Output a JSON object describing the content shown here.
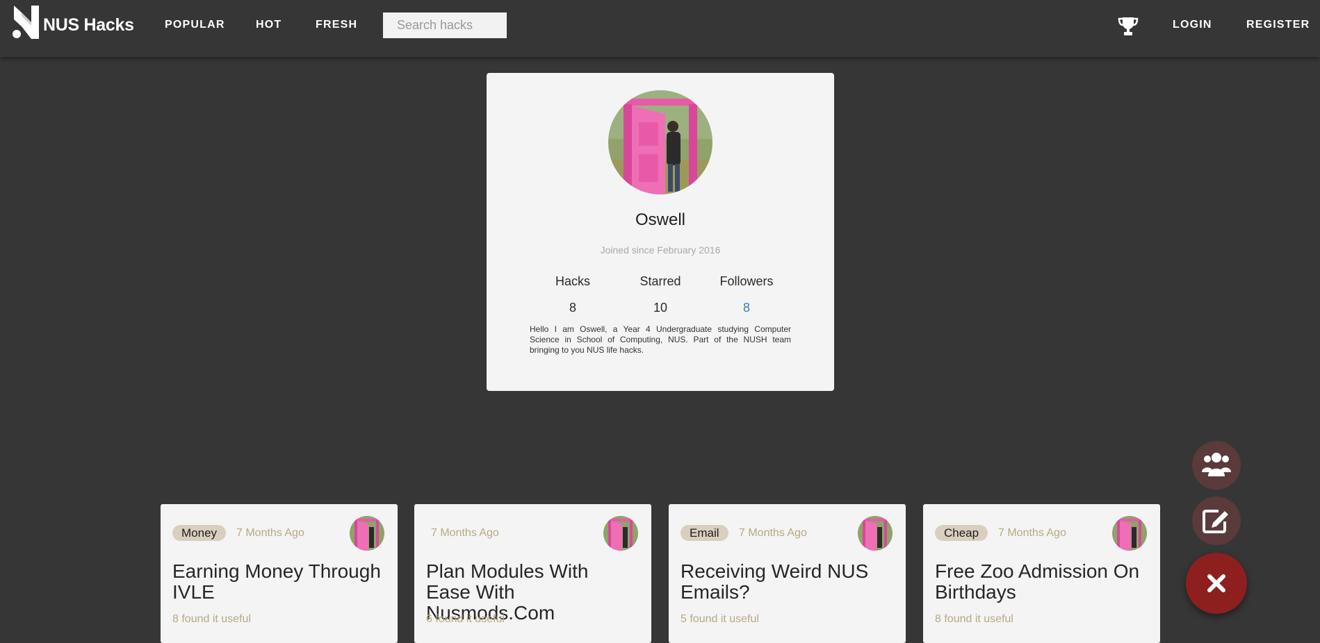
{
  "nav": {
    "brand": "NUS Hacks",
    "links": [
      "POPULAR",
      "HOT",
      "FRESH"
    ],
    "search_placeholder": "Search hacks",
    "login": "LOGIN",
    "register": "REGISTER"
  },
  "profile": {
    "name": "Oswell",
    "joined": "Joined since February 2016",
    "stats": [
      {
        "label": "Hacks",
        "value": "8"
      },
      {
        "label": "Starred",
        "value": "10"
      },
      {
        "label": "Followers",
        "value": "8"
      }
    ],
    "bio": "Hello I am Oswell, a Year 4 Undergraduate studying Computer Science in School of Computing, NUS. Part of the NUSH team bringing to you NUS life hacks."
  },
  "hacks": [
    {
      "tag": "Money",
      "time": "7 Months Ago",
      "title": "Earning Money Through IVLE",
      "useful": "8 found it useful"
    },
    {
      "tag": "",
      "time": "7 Months Ago",
      "title": "Plan Modules With Ease With Nusmods.Com",
      "useful": "6 found it useful"
    },
    {
      "tag": "Email",
      "time": "7 Months Ago",
      "title": "Receiving Weird NUS Emails?",
      "useful": "5 found it useful"
    },
    {
      "tag": "Cheap",
      "time": "7 Months Ago",
      "title": "Free Zoo Admission On Birthdays",
      "useful": "8 found it useful"
    }
  ],
  "colors": {
    "background": "#363636",
    "card": "#f4f4f4",
    "tag_bg": "#d9cfbf",
    "muted_gold": "#b9a882",
    "link_blue": "#3b7bbf",
    "fab_main": "#8e1f1f",
    "fab_secondary": "#5a3a3a"
  },
  "icons": {
    "logo": "nus-hacks-logo",
    "leaderboard": "trophy-icon",
    "fab_users": "users-icon",
    "fab_edit": "edit-icon",
    "fab_close": "close-icon"
  }
}
